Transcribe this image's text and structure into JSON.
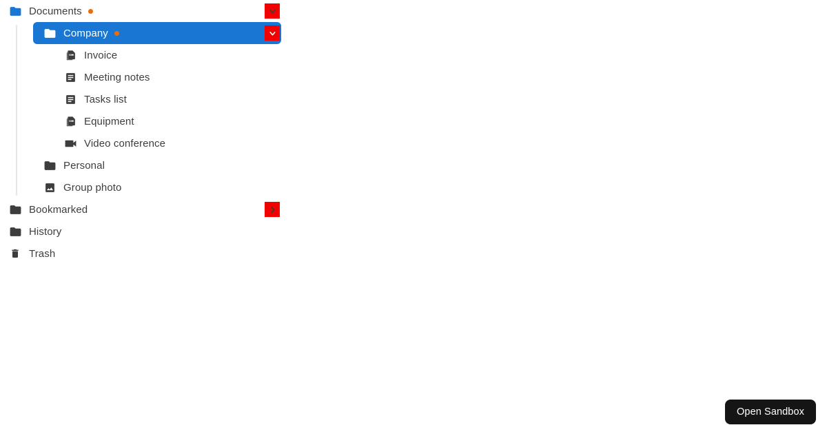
{
  "app": {
    "background": "#ffffff",
    "text_color": "#3d3d3d",
    "selected_row_color": "#1976d2",
    "toggle_button_color": "#f40000",
    "status_dot_color": "#ef6c00",
    "guide_line_color": "#e6e6e6"
  },
  "tree": {
    "nodes": [
      {
        "id": "documents",
        "label": "Documents",
        "icon": "folder-open-icon",
        "icon_color": "#1976d2",
        "depth": 0,
        "has_dot": true,
        "selected": false,
        "toggle": "chevron-down-icon",
        "toggle_state": "expanded",
        "toggle_chevron_color": "#3d3d3d"
      },
      {
        "id": "company",
        "label": "Company",
        "icon": "folder-open-icon",
        "icon_color": "#ffffff",
        "depth": 1,
        "has_dot": true,
        "selected": true,
        "toggle": "chevron-down-icon",
        "toggle_state": "expanded",
        "toggle_chevron_color": "#ffffff"
      },
      {
        "id": "invoice",
        "label": "Invoice",
        "icon": "pdf-file-icon",
        "icon_color": "#3d3d3d",
        "depth": 2,
        "has_dot": false,
        "selected": false,
        "toggle": null,
        "toggle_state": null,
        "toggle_chevron_color": null
      },
      {
        "id": "meeting-notes",
        "label": "Meeting notes",
        "icon": "article-icon",
        "icon_color": "#3d3d3d",
        "depth": 2,
        "has_dot": false,
        "selected": false,
        "toggle": null,
        "toggle_state": null,
        "toggle_chevron_color": null
      },
      {
        "id": "tasks-list",
        "label": "Tasks list",
        "icon": "article-icon",
        "icon_color": "#3d3d3d",
        "depth": 2,
        "has_dot": false,
        "selected": false,
        "toggle": null,
        "toggle_state": null,
        "toggle_chevron_color": null
      },
      {
        "id": "equipment",
        "label": "Equipment",
        "icon": "pdf-file-icon",
        "icon_color": "#3d3d3d",
        "depth": 2,
        "has_dot": false,
        "selected": false,
        "toggle": null,
        "toggle_state": null,
        "toggle_chevron_color": null
      },
      {
        "id": "video-conference",
        "label": "Video conference",
        "icon": "video-camera-icon",
        "icon_color": "#3d3d3d",
        "depth": 2,
        "has_dot": false,
        "selected": false,
        "toggle": null,
        "toggle_state": null,
        "toggle_chevron_color": null
      },
      {
        "id": "personal",
        "label": "Personal",
        "icon": "folder-open-icon",
        "icon_color": "#3d3d3d",
        "depth": 1,
        "has_dot": false,
        "selected": false,
        "toggle": null,
        "toggle_state": null,
        "toggle_chevron_color": null
      },
      {
        "id": "group-photo",
        "label": "Group photo",
        "icon": "image-icon",
        "icon_color": "#3d3d3d",
        "depth": 1,
        "has_dot": false,
        "selected": false,
        "toggle": null,
        "toggle_state": null,
        "toggle_chevron_color": null
      },
      {
        "id": "bookmarked",
        "label": "Bookmarked",
        "icon": "folder-open-icon",
        "icon_color": "#3d3d3d",
        "depth": 0,
        "has_dot": false,
        "selected": false,
        "toggle": "chevron-right-icon",
        "toggle_state": "collapsed",
        "toggle_chevron_color": "#3d3d3d"
      },
      {
        "id": "history",
        "label": "History",
        "icon": "folder-open-icon",
        "icon_color": "#3d3d3d",
        "depth": 0,
        "has_dot": false,
        "selected": false,
        "toggle": null,
        "toggle_state": null,
        "toggle_chevron_color": null
      },
      {
        "id": "trash",
        "label": "Trash",
        "icon": "trash-icon",
        "icon_color": "#3d3d3d",
        "depth": 0,
        "has_dot": false,
        "selected": false,
        "toggle": null,
        "toggle_state": null,
        "toggle_chevron_color": null
      }
    ]
  },
  "footer": {
    "open_sandbox_label": "Open Sandbox"
  }
}
